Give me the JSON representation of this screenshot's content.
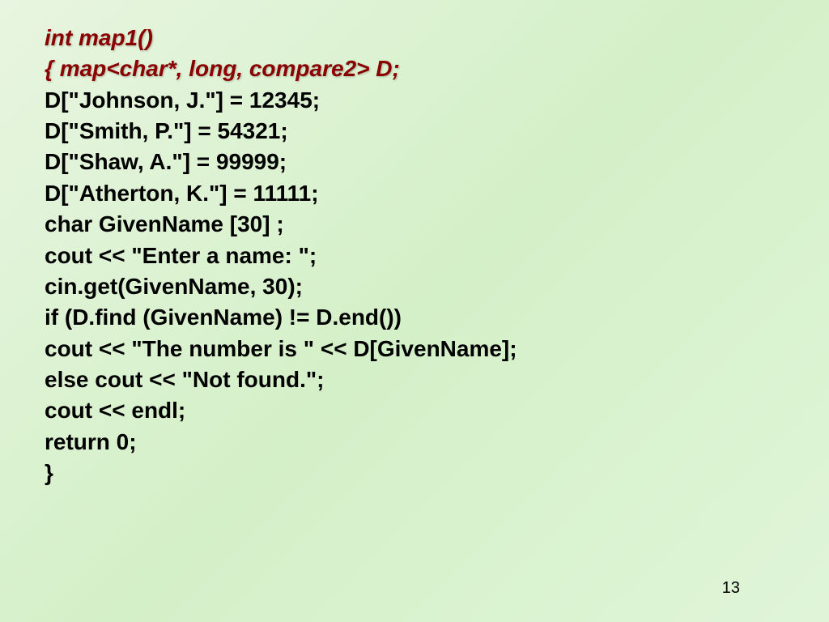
{
  "code": {
    "line1_part1": "int map1()",
    "line2_open": "{   ",
    "line2_part1": "map<char*, long, ",
    "line2_underline": "compare2",
    "line2_part2": "> D;",
    "line3": "D[\"Johnson, J.\"]   =  12345;",
    "line4": "D[\"Smith, P.\"]     =  54321;",
    "line5": "D[\"Shaw, A.\"]      =  99999;",
    "line6": "D[\"Atherton, K.\"]  =  11111;",
    "line7": "char GivenName [30] ;",
    "line8": "cout  <<  \"Enter a name:  \";",
    "line9": "cin.get(GivenName,  30);",
    "line10": "if  (D.find (GivenName) != D.end())",
    "line11": "      cout << \"The number is \" << D[GivenName];",
    "line12": "else cout  <<  \"Not  found.\";",
    "line13": "cout  <<  endl;",
    "line14": "return  0;",
    "line15": "}"
  },
  "page_number": "13"
}
